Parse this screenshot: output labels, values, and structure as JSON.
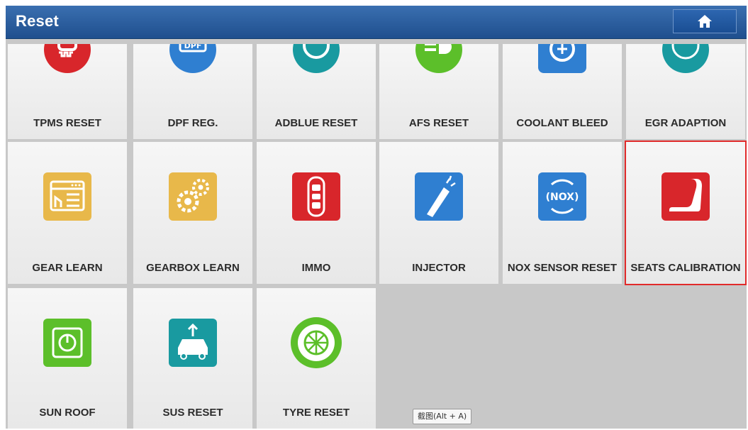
{
  "header": {
    "title": "Reset",
    "home_icon": "home-icon"
  },
  "tiles": [
    {
      "label": "TPMS RESET",
      "icon": "tpms-icon",
      "color": "#d8262b"
    },
    {
      "label": "DPF REG.",
      "icon": "dpf-icon",
      "color": "#2f7fd1"
    },
    {
      "label": "ADBLUE RESET",
      "icon": "adblue-icon",
      "color": "#199aa0"
    },
    {
      "label": "AFS RESET",
      "icon": "afs-icon",
      "color": "#5cbf2a"
    },
    {
      "label": "COOLANT BLEED",
      "icon": "coolant-icon",
      "color": "#2f7fd1"
    },
    {
      "label": "EGR ADAPTION",
      "icon": "egr-icon",
      "color": "#199aa0"
    },
    {
      "label": "GEAR LEARN",
      "icon": "gear-learn-icon",
      "color": "#e8b84a"
    },
    {
      "label": "GEARBOX LEARN",
      "icon": "gearbox-learn-icon",
      "color": "#e8b84a"
    },
    {
      "label": "IMMO",
      "icon": "immo-icon",
      "color": "#d8262b"
    },
    {
      "label": "INJECTOR",
      "icon": "injector-icon",
      "color": "#2f7fd1"
    },
    {
      "label": "NOX SENSOR RESET",
      "icon": "nox-sensor-icon",
      "color": "#2f7fd1"
    },
    {
      "label": "SEATS CALIBRATION",
      "icon": "seat-icon",
      "color": "#d8262b",
      "selected": true
    },
    {
      "label": "SUN ROOF",
      "icon": "sunroof-icon",
      "color": "#5cbf2a"
    },
    {
      "label": "SUS RESET",
      "icon": "suspension-icon",
      "color": "#199aa0"
    },
    {
      "label": "TYRE RESET",
      "icon": "tyre-icon",
      "color": "#5cbf2a"
    }
  ],
  "tooltip": {
    "text": "截图(Alt + A)"
  }
}
